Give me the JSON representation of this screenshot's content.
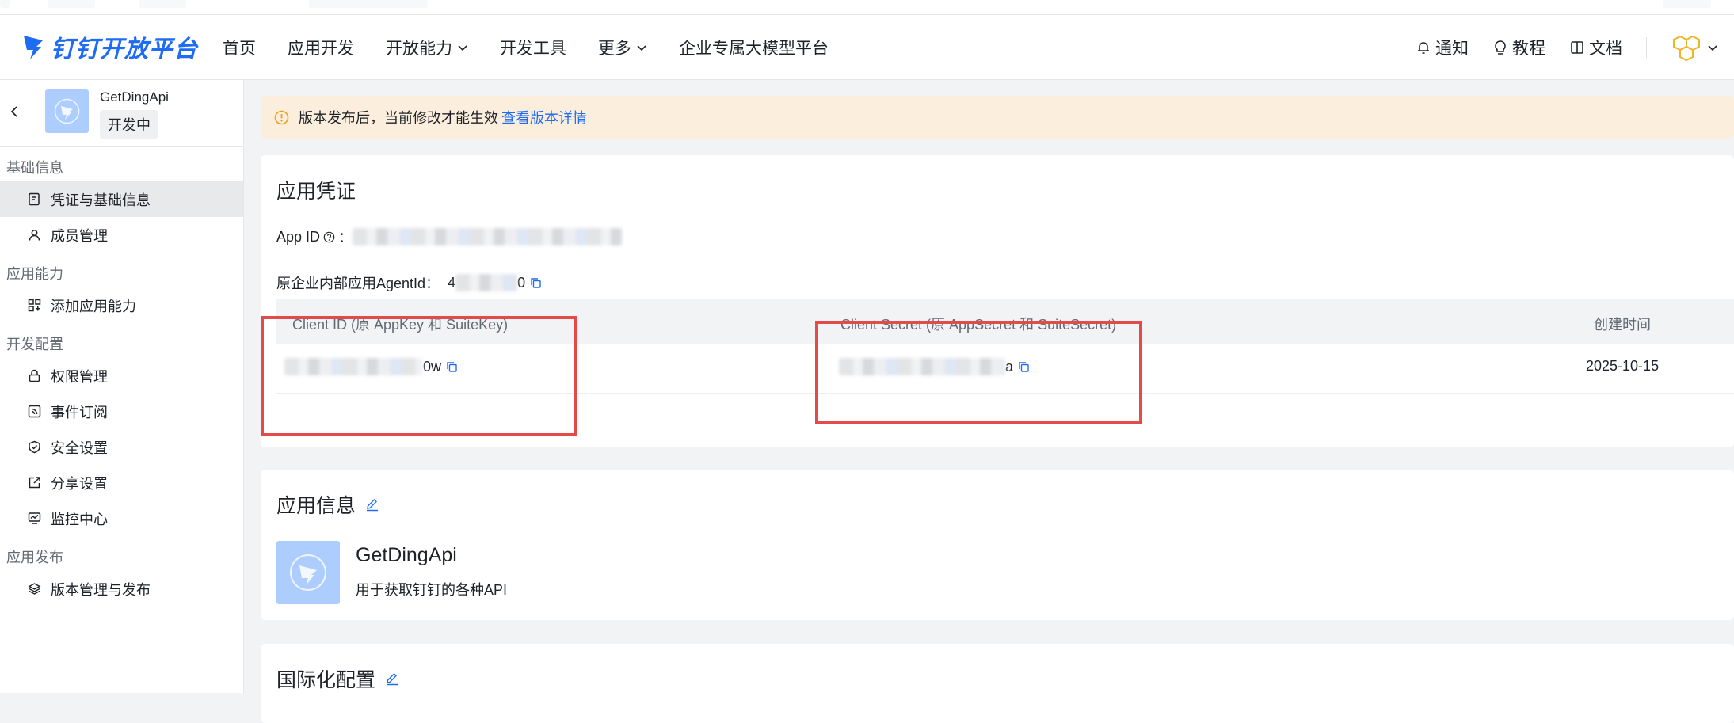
{
  "brand": {
    "name": "钉钉开放平台",
    "color": "#1f6cf4"
  },
  "nav": {
    "items": [
      {
        "label": "首页"
      },
      {
        "label": "应用开发"
      },
      {
        "label": "开放能力",
        "dropdown": true
      },
      {
        "label": "开发工具"
      },
      {
        "label": "更多",
        "dropdown": true
      },
      {
        "label": "企业专属大模型平台"
      }
    ],
    "right": {
      "notify": "通知",
      "tutorial": "教程",
      "docs": "文档"
    }
  },
  "sidebar": {
    "app_name": "GetDingApi",
    "app_status": "开发中",
    "groups": [
      {
        "title": "基础信息",
        "items": [
          {
            "label": "凭证与基础信息",
            "icon": "credential-icon",
            "active": true
          },
          {
            "label": "成员管理",
            "icon": "user-icon"
          }
        ]
      },
      {
        "title": "应用能力",
        "items": [
          {
            "label": "添加应用能力",
            "icon": "grid-add-icon"
          }
        ]
      },
      {
        "title": "开发配置",
        "items": [
          {
            "label": "权限管理",
            "icon": "lock-icon"
          },
          {
            "label": "事件订阅",
            "icon": "rss-icon"
          },
          {
            "label": "安全设置",
            "icon": "shield-icon"
          },
          {
            "label": "分享设置",
            "icon": "share-icon"
          },
          {
            "label": "监控中心",
            "icon": "monitor-icon"
          }
        ]
      },
      {
        "title": "应用发布",
        "items": [
          {
            "label": "版本管理与发布",
            "icon": "layers-icon"
          }
        ]
      }
    ]
  },
  "banner": {
    "text": "版本发布后，当前修改才能生效",
    "link": "查看版本详情"
  },
  "credentials": {
    "title": "应用凭证",
    "app_id_label": "App ID",
    "agent_id_label": "原企业内部应用AgentId：",
    "agent_id_prefix": "4",
    "agent_id_suffix": "0",
    "table": {
      "headers": {
        "client_id": "Client ID (原 AppKey 和 SuiteKey)",
        "client_secret": "Client Secret (原 AppSecret 和 SuiteSecret)",
        "created": "创建时间"
      },
      "row": {
        "client_id_suffix": "0w",
        "client_secret_suffix": "a",
        "created": "2025-10-15"
      }
    }
  },
  "app_info": {
    "title": "应用信息",
    "name": "GetDingApi",
    "description": "用于获取钉钉的各种API"
  },
  "i18n": {
    "title": "国际化配置"
  },
  "colors": {
    "highlight": "#e34b4b",
    "banner_bg": "#fbeedc",
    "link": "#1f6cf4"
  }
}
